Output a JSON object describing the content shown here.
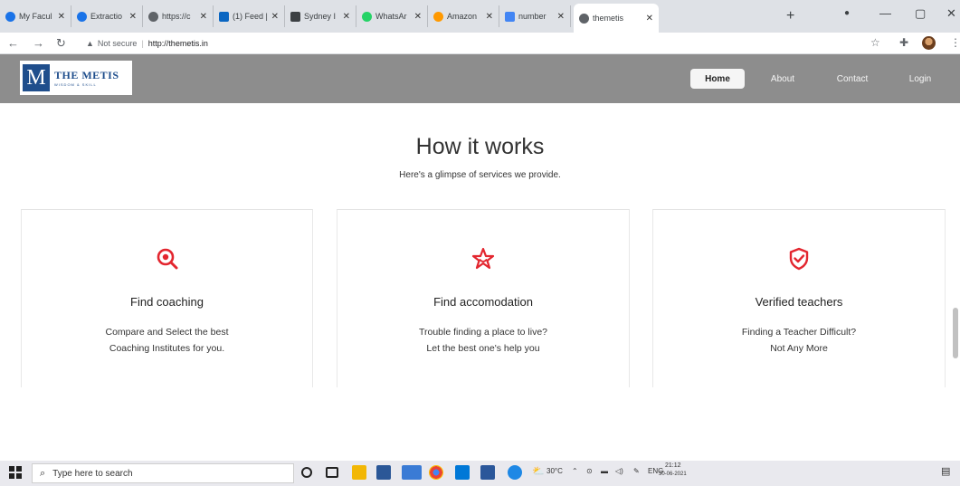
{
  "browser": {
    "tabs": [
      {
        "title": "My Facul",
        "favicon_color": "#1a73e8"
      },
      {
        "title": "Extractio",
        "favicon_color": "#1a73e8"
      },
      {
        "title": "https://c",
        "favicon_color": "#5f6368"
      },
      {
        "title": "(1) Feed |",
        "favicon_color": "#0a66c2"
      },
      {
        "title": "Sydney I",
        "favicon_color": "#3c4043"
      },
      {
        "title": "WhatsAr",
        "favicon_color": "#25d366"
      },
      {
        "title": "Amazon",
        "favicon_color": "#ff9900"
      },
      {
        "title": "number",
        "favicon_color": "#4285f4"
      },
      {
        "title": "themetis",
        "favicon_color": "#5f6368",
        "active": true
      }
    ],
    "new_tab": "+",
    "address": {
      "security": "Not secure",
      "url": "http://themetis.in"
    }
  },
  "site": {
    "logo": {
      "initial": "M",
      "name": "THE METIS",
      "tagline": "WISDOM & SKILL"
    },
    "nav": [
      {
        "label": "Home",
        "active": true
      },
      {
        "label": "About"
      },
      {
        "label": "Contact"
      },
      {
        "label": "Login"
      }
    ],
    "heading": "How it works",
    "subheading": "Here's a glimpse of services we provide.",
    "cards": [
      {
        "title": "Find coaching",
        "line1": "Compare and Select the best",
        "line2": "Coaching Institutes for you.",
        "icon": "search-icon"
      },
      {
        "title": "Find accomodation",
        "line1": "Trouble finding a place to live?",
        "line2": "Let the best one's help you",
        "icon": "star-icon"
      },
      {
        "title": "Verified teachers",
        "line1": "Finding a Teacher Difficult?",
        "line2": "Not Any More",
        "icon": "shield-check-icon"
      }
    ],
    "accent_color": "#e3262f"
  },
  "taskbar": {
    "search_placeholder": "Type here to search",
    "weather": "30°C",
    "language": "ENG",
    "time": "21:12",
    "date": "30-06-2021"
  }
}
